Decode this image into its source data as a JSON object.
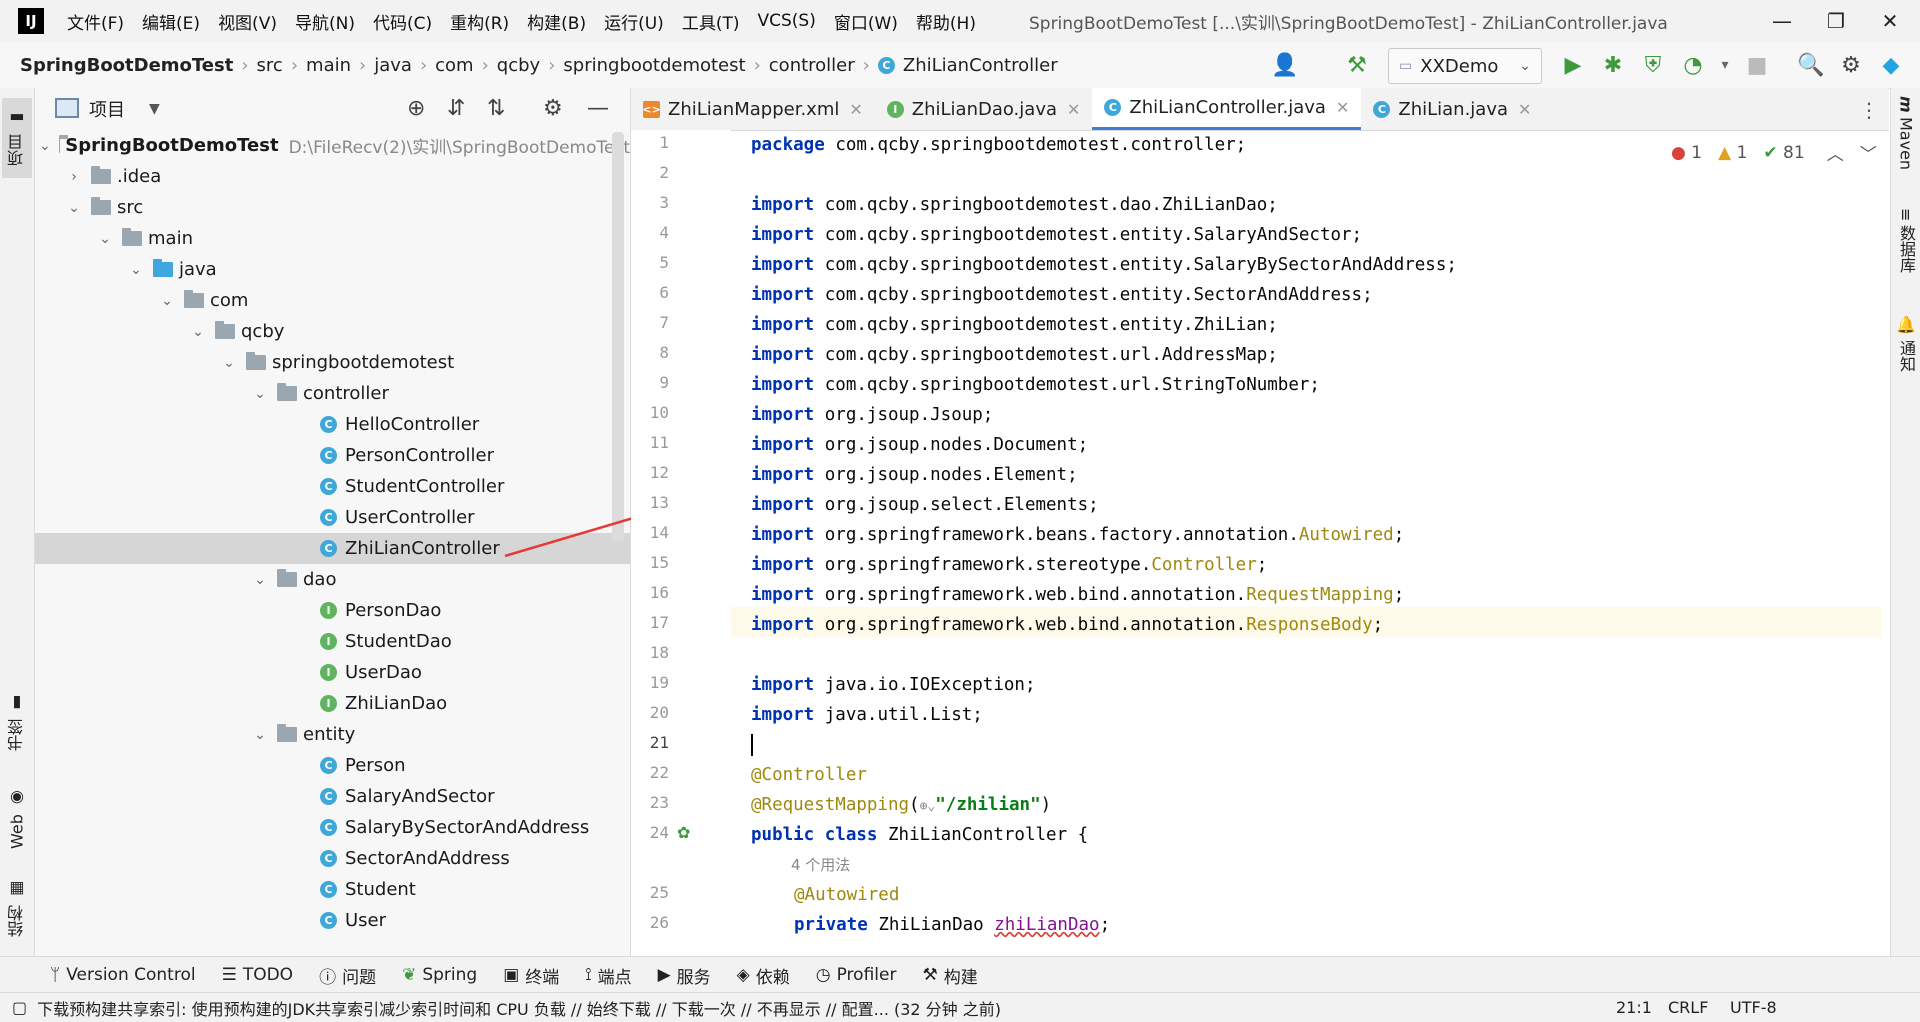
{
  "menu": {
    "items": [
      "文件(F)",
      "编辑(E)",
      "视图(V)",
      "导航(N)",
      "代码(C)",
      "重构(R)",
      "构建(B)",
      "运行(U)",
      "工具(T)",
      "VCS(S)",
      "窗口(W)",
      "帮助(H)"
    ],
    "window_title": "SpringBootDemoTest [...\\实训\\SpringBootDemoTest] - ZhiLianController.java"
  },
  "breadcrumb": [
    "SpringBootDemoTest",
    "src",
    "main",
    "java",
    "com",
    "qcby",
    "springbootdemotest",
    "controller",
    "ZhiLianController"
  ],
  "run_config": "XXDemo",
  "project": {
    "title": "项目",
    "root": {
      "name": "SpringBootDemoTest",
      "path": "D:\\FileRecv(2)\\实训\\SpringBootDemoTest"
    },
    "tree": [
      ".idea",
      "src",
      "main",
      "java",
      "com",
      "qcby",
      "springbootdemotest",
      "controller",
      "HelloController",
      "PersonController",
      "StudentController",
      "UserController",
      "ZhiLianController",
      "dao",
      "PersonDao",
      "StudentDao",
      "UserDao",
      "ZhiLianDao",
      "entity",
      "Person",
      "SalaryAndSector",
      "SalaryBySectorAndAddress",
      "SectorAndAddress",
      "Student",
      "User"
    ]
  },
  "editor_tabs": [
    {
      "label": "ZhiLianMapper.xml",
      "icon": "xml-icon"
    },
    {
      "label": "ZhiLianDao.java",
      "icon": "interface-icon"
    },
    {
      "label": "ZhiLianController.java",
      "icon": "class-icon"
    },
    {
      "label": "ZhiLian.java",
      "icon": "class-icon"
    }
  ],
  "inspections": {
    "errors": "1",
    "warnings": "1",
    "ok": "81"
  },
  "gutter": [
    "1",
    "2",
    "3",
    "4",
    "5",
    "6",
    "7",
    "8",
    "9",
    "10",
    "11",
    "12",
    "13",
    "14",
    "15",
    "16",
    "17",
    "18",
    "19",
    "20",
    "21",
    "22",
    "23",
    "24",
    "25",
    "26"
  ],
  "code": {
    "l1": "com.qcby.springbootdemotest.controller;",
    "l3": "com.qcby.springbootdemotest.dao.ZhiLianDao;",
    "l4": "com.qcby.springbootdemotest.entity.SalaryAndSector;",
    "l5": "com.qcby.springbootdemotest.entity.SalaryBySectorAndAddress;",
    "l6": "com.qcby.springbootdemotest.entity.SectorAndAddress;",
    "l7": "com.qcby.springbootdemotest.entity.ZhiLian;",
    "l8": "com.qcby.springbootdemotest.url.AddressMap;",
    "l9": "com.qcby.springbootdemotest.url.StringToNumber;",
    "l10": "org.jsoup.Jsoup;",
    "l11": "org.jsoup.nodes.Document;",
    "l12": "org.jsoup.nodes.Element;",
    "l13": "org.jsoup.select.Elements;",
    "l14a": "org.springframework.beans.factory.annotation.",
    "l14b": "Autowired",
    "l15a": "org.springframework.stereotype.",
    "l15b": "Controller",
    "l16a": "org.springframework.web.bind.annotation.",
    "l16b": "RequestMapping",
    "l17a": "org.springframework.web.bind.annotation.",
    "l17b": "ResponseBody",
    "l19": "java.io.IOException;",
    "l20": "java.util.List;",
    "l22": "@Controller",
    "l23a": "@RequestMapping",
    "l23b": "\"/zhilian\"",
    "l24": "ZhiLianController {",
    "hint": "4 个用法",
    "l25": "@Autowired",
    "l26a": "ZhiLianDao",
    "l26b": "zhiLianDao"
  },
  "keywords": {
    "package": "package",
    "import": "import",
    "public": "public",
    "class": "class",
    "private": "private"
  },
  "bottom_tools": [
    "Version Control",
    "TODO",
    "问题",
    "Spring",
    "终端",
    "端点",
    "服务",
    "依赖",
    "Profiler",
    "构建"
  ],
  "status": {
    "message": "下载预构建共享索引: 使用预构建的JDK共享索引减少索引时间和 CPU 负载 // 始终下载 // 下载一次 // 不再显示 // 配置... (32 分钟 之前)",
    "position": "21:1",
    "line_sep": "CRLF",
    "encoding": "UTF-8"
  },
  "side_tabs": {
    "left": [
      "项目",
      "书签",
      "Web",
      "结构"
    ],
    "right": [
      "Maven",
      "数据库",
      "通知"
    ]
  }
}
